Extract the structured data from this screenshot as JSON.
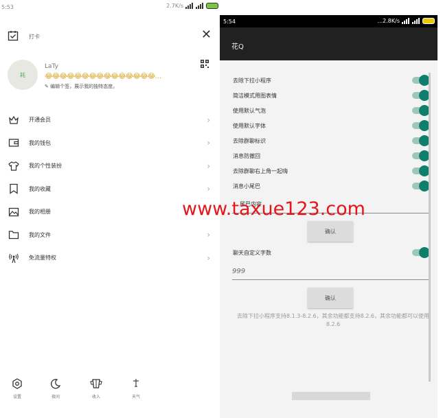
{
  "left": {
    "status_time": "5:53",
    "status_right": "2.7K/s",
    "checkin_label": "打卡",
    "user": {
      "avatar_text": "耗",
      "name": "LaTy",
      "emoji_row": "😂😂😂😂😂😂😂😂😂😂😂😂😂😂😂…",
      "signature": "编辑个签，展示我的独特态度。"
    },
    "menu": [
      {
        "label": "开通会员",
        "icon": "crown-icon"
      },
      {
        "label": "我的钱包",
        "icon": "wallet-icon"
      },
      {
        "label": "我的个性装扮",
        "icon": "tshirt-icon"
      },
      {
        "label": "我的收藏",
        "icon": "bookmark-icon"
      },
      {
        "label": "我的相册",
        "icon": "photo-icon"
      },
      {
        "label": "我的文件",
        "icon": "folder-icon"
      },
      {
        "label": "免流量特权",
        "icon": "signal-icon"
      }
    ],
    "bottom": [
      {
        "label": "设置",
        "icon": "gear-icon"
      },
      {
        "label": "夜间",
        "icon": "moon-icon"
      },
      {
        "label": "收入",
        "icon": "cup-icon"
      },
      {
        "label": "天气",
        "icon": "weather-icon"
      }
    ]
  },
  "right": {
    "status_time": "5:54",
    "status_right": "...2.8K/s",
    "app_title": "花Q",
    "settings": [
      {
        "label": "去除下拉小程序",
        "on": true
      },
      {
        "label": "简洁模式用图表情",
        "on": true
      },
      {
        "label": "使用默认气泡",
        "on": true
      },
      {
        "label": "使用默认字体",
        "on": true
      },
      {
        "label": "去除群聊标识",
        "on": true
      },
      {
        "label": "消息防撤回",
        "on": true
      },
      {
        "label": "去除群聊右上角一起嗨",
        "on": true
      },
      {
        "label": "消息小尾巴",
        "on": true
      }
    ],
    "tail_label": "尾巴内容",
    "confirm_label": "确认",
    "custom_label": "聊天自定义字数",
    "custom_on": true,
    "custom_value": "999",
    "confirm2_label": "确认",
    "note": "去除下拉小程序支持8.1.3-8.2.6，其余功能都支持8.2.6，其余功能都可以使用8.2.6"
  },
  "watermark": "www.taxue123.com",
  "colors": {
    "toggle_thumb": "#0f7f6b",
    "toggle_track": "#9fc6bb",
    "watermark": "#e4161b",
    "app_bar": "#212121"
  }
}
